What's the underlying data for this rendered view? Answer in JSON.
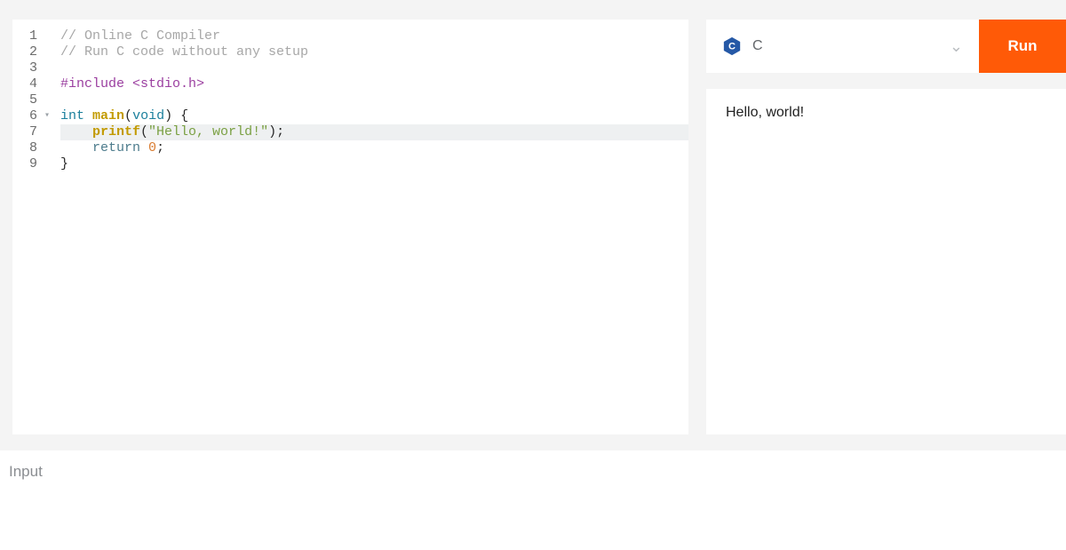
{
  "editor": {
    "highlighted_line": 7,
    "fold_line": 6,
    "lines": [
      {
        "n": 1,
        "tokens": [
          {
            "cls": "c-comment",
            "t": "// Online C Compiler"
          }
        ]
      },
      {
        "n": 2,
        "tokens": [
          {
            "cls": "c-comment",
            "t": "// Run C code without any setup"
          }
        ]
      },
      {
        "n": 3,
        "tokens": []
      },
      {
        "n": 4,
        "tokens": [
          {
            "cls": "c-prep",
            "t": "#include <stdio.h>"
          }
        ]
      },
      {
        "n": 5,
        "tokens": []
      },
      {
        "n": 6,
        "tokens": [
          {
            "cls": "c-type",
            "t": "int"
          },
          {
            "cls": "c-plain",
            "t": " "
          },
          {
            "cls": "c-func",
            "t": "main"
          },
          {
            "cls": "c-punct",
            "t": "("
          },
          {
            "cls": "c-type",
            "t": "void"
          },
          {
            "cls": "c-punct",
            "t": ") {"
          }
        ]
      },
      {
        "n": 7,
        "tokens": [
          {
            "cls": "c-plain",
            "t": "    "
          },
          {
            "cls": "c-func",
            "t": "printf"
          },
          {
            "cls": "c-punct",
            "t": "("
          },
          {
            "cls": "c-str",
            "t": "\"Hello, world!\""
          },
          {
            "cls": "c-punct",
            "t": ");"
          }
        ]
      },
      {
        "n": 8,
        "tokens": [
          {
            "cls": "c-plain",
            "t": "    "
          },
          {
            "cls": "c-kw",
            "t": "return"
          },
          {
            "cls": "c-plain",
            "t": " "
          },
          {
            "cls": "c-num",
            "t": "0"
          },
          {
            "cls": "c-punct",
            "t": ";"
          }
        ]
      },
      {
        "n": 9,
        "tokens": [
          {
            "cls": "c-punct",
            "t": "}"
          }
        ]
      }
    ]
  },
  "language": {
    "name": "C",
    "icon": "c-lang-icon"
  },
  "run_label": "Run",
  "output_text": "Hello, world!",
  "input_panel": {
    "label": "Input"
  }
}
